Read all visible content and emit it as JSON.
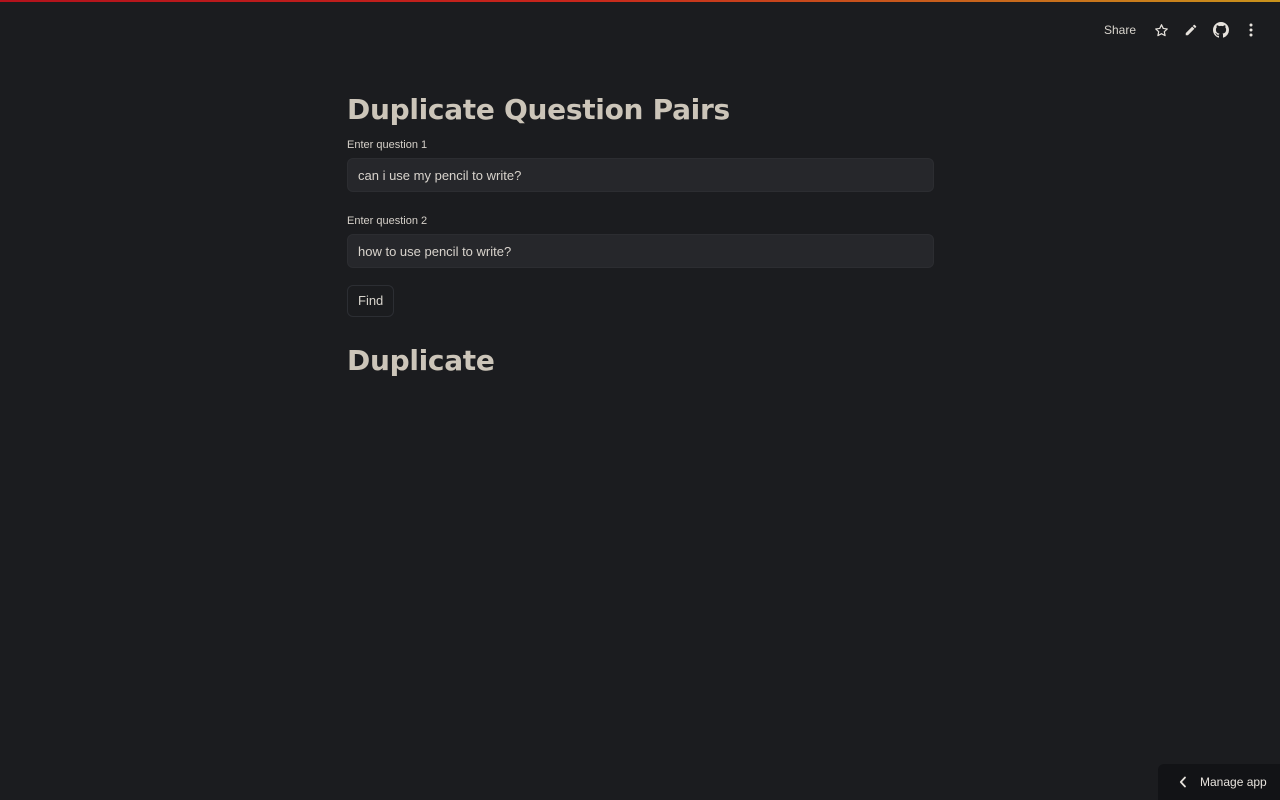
{
  "header": {
    "share_label": "Share",
    "icons": [
      "star-icon",
      "pencil-icon",
      "github-icon",
      "kebab-menu-icon"
    ]
  },
  "main": {
    "title": "Duplicate Question Pairs",
    "question1": {
      "label": "Enter question 1",
      "value": "can i use my pencil to write?"
    },
    "question2": {
      "label": "Enter question 2",
      "value": "how to use pencil to write?"
    },
    "find_label": "Find",
    "result": "Duplicate"
  },
  "footer": {
    "manage_app_label": "Manage app"
  },
  "colors": {
    "background": "#1b1c1f",
    "text": "#ccc5b9",
    "input_bg": "#26272b",
    "accent_gradient_start": "#b3121c",
    "accent_gradient_end": "#c9931c"
  }
}
